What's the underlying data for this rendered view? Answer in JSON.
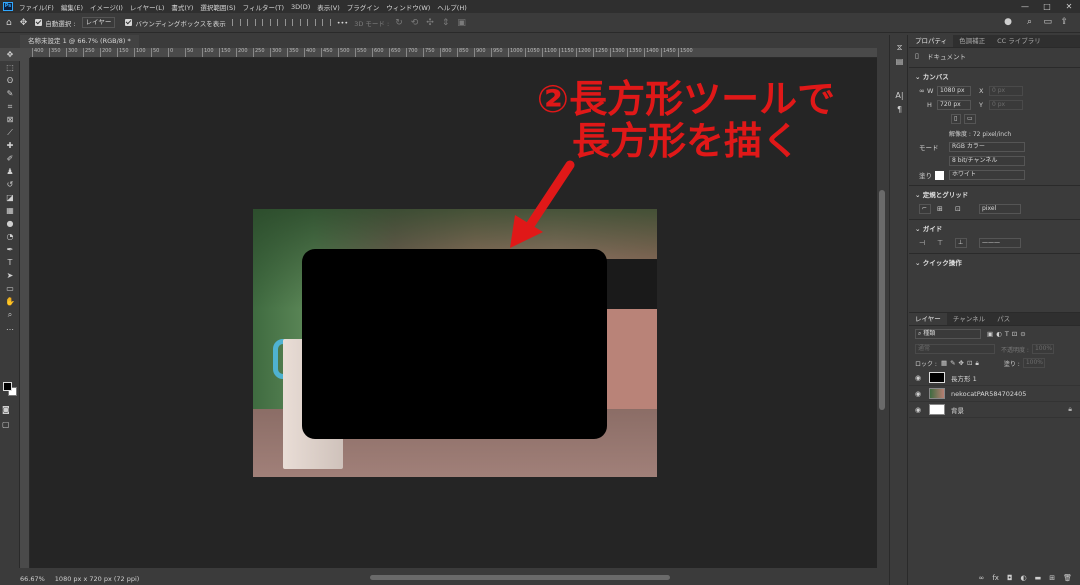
{
  "app": {
    "logo": "Ps",
    "menu": [
      "ファイル(F)",
      "編集(E)",
      "イメージ(I)",
      "レイヤー(L)",
      "書式(Y)",
      "選択範囲(S)",
      "フィルター(T)",
      "3D(D)",
      "表示(V)",
      "プラグイン",
      "ウィンドウ(W)",
      "ヘルプ(H)"
    ],
    "window_controls": [
      "—",
      "□",
      "✕"
    ]
  },
  "options_bar": {
    "auto_select_label": "自動選択 :",
    "auto_select_value": "レイヤー",
    "bounding_box_label": "バウンディングボックスを表示",
    "more": "•••",
    "mode_3d_label": "3D モード :"
  },
  "document": {
    "tab_title": "名称未設定 1 @ 66.7% (RGB/8) *",
    "ruler_ticks": [
      "400",
      "350",
      "300",
      "250",
      "200",
      "150",
      "100",
      "50",
      "0",
      "50",
      "100",
      "150",
      "200",
      "250",
      "300",
      "350",
      "400",
      "450",
      "500",
      "550",
      "600",
      "650",
      "700",
      "750",
      "800",
      "850",
      "900",
      "950",
      "1000",
      "1050",
      "1100",
      "1150",
      "1200",
      "1250",
      "1300",
      "1350",
      "1400",
      "1450",
      "1500"
    ],
    "annotation": "②長方形ツールで\n長方形を描く"
  },
  "status": {
    "zoom": "66.67%",
    "size": "1080 px x 720 px (72 ppi)"
  },
  "properties": {
    "tabs": [
      "プロパティ",
      "色調補正",
      "CC ライブラリ"
    ],
    "doc_label": "ドキュメント",
    "canvas_title": "カンバス",
    "w_label": "W",
    "w_value": "1080 px",
    "h_label": "H",
    "h_value": "720 px",
    "x_label": "X",
    "x_value": "0 px",
    "y_label": "Y",
    "y_value": "0 px",
    "resolution": "解像度 : 72 pixel/inch",
    "mode_label": "モード",
    "mode_value": "RGB カラー",
    "depth_value": "8 bit/チャンネル",
    "fill_label": "塗り",
    "fill_value": "ホワイト",
    "rulers_title": "定規とグリッド",
    "rulers_unit": "pixel",
    "guides_title": "ガイド",
    "quick_title": "クイック操作"
  },
  "layers": {
    "tabs": [
      "レイヤー",
      "チャンネル",
      "パス"
    ],
    "filter_value": "種類",
    "blend_mode": "通常",
    "opacity_label": "不透明度 :",
    "opacity_value": "100%",
    "lock_label": "ロック :",
    "fill_label": "塗り :",
    "fill_value": "100%",
    "items": [
      {
        "name": "長方形 1"
      },
      {
        "name": "nekocatPAR584702405"
      },
      {
        "name": "背景"
      }
    ]
  }
}
